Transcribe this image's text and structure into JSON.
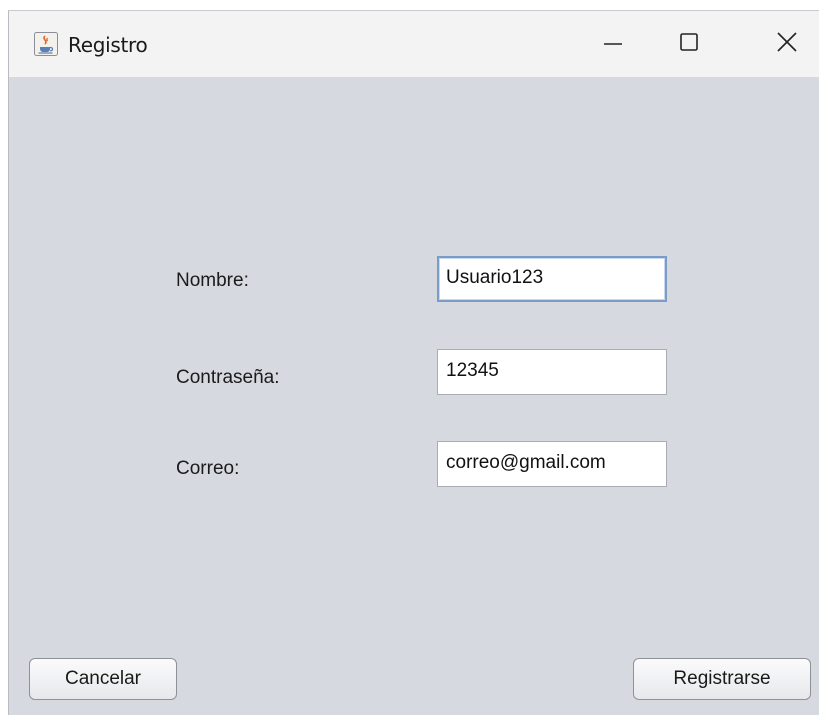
{
  "window": {
    "title": "Registro",
    "icon": "java-cup-icon",
    "controls": {
      "minimize_icon": "minimize-icon",
      "maximize_icon": "maximize-icon",
      "close_icon": "close-icon"
    }
  },
  "form": {
    "fields": [
      {
        "label": "Nombre:",
        "value": "Usuario123",
        "focused": true
      },
      {
        "label": "Contraseña:",
        "value": "12345",
        "focused": false
      },
      {
        "label": "Correo:",
        "value": "correo@gmail.com",
        "focused": false
      }
    ]
  },
  "buttons": {
    "cancel_label": "Cancelar",
    "register_label": "Registrarse"
  },
  "colors": {
    "window_background": "#d6d9e0",
    "titlebar_background": "#f3f3f3",
    "focus_border": "#7a9cc6"
  }
}
